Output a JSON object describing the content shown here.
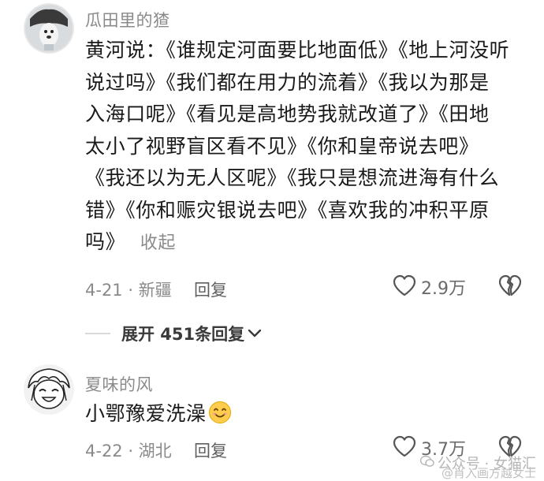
{
  "comments": [
    {
      "username": "瓜田里的猹",
      "text": "黄河说：《谁规定河面要比地面低》《地上河没听说过吗》《我们都在用力的流着》《我以为那是入海口呢》《看见是高地势我就改道了》《田地太小了视野盲区看不见》《你和皇帝说去吧》《我还以为无人区呢》《我只是想流进海有什么错》《你和赈灾银说去吧》《喜欢我的冲积平原吗》",
      "lines": [
        "黄河说：《谁规定河面要比地面低》《地上河没听",
        "说过吗》《我们都在用力的流着》《我以为那是",
        "入海口呢》《看见是高地势我就改道了》《田地",
        "太小了视野盲区看不见》《你和皇帝说去吧》",
        "《我还以为无人区呢》《我只是想流进海有什么",
        "错》《你和赈灾银说去吧》《喜欢我的冲积平原",
        "吗》"
      ],
      "collapse_label": "收起",
      "date_location": "4-21 · 新疆",
      "reply_label": "回复",
      "like_count": "2.9万"
    },
    {
      "username": "夏味的风",
      "text": "小鄂豫爱洗澡😊",
      "text_plain": "小鄂豫爱洗澡",
      "emoji": "😊",
      "date_location": "4-22 · 湖北",
      "reply_label": "回复",
      "like_count": "3.7万"
    }
  ],
  "expand": {
    "label": "展开 451条回复"
  },
  "watermark": {
    "line1": "公众号 · 女猫汇",
    "line2": "@肖入画方越女士"
  },
  "icons": {
    "like": "heart-outline-icon",
    "dislike": "broken-heart-icon",
    "expand": "chevron-down-icon"
  },
  "colors": {
    "meta": "#8a8a8a",
    "text": "#1a1a1a",
    "bg": "#ffffff"
  }
}
